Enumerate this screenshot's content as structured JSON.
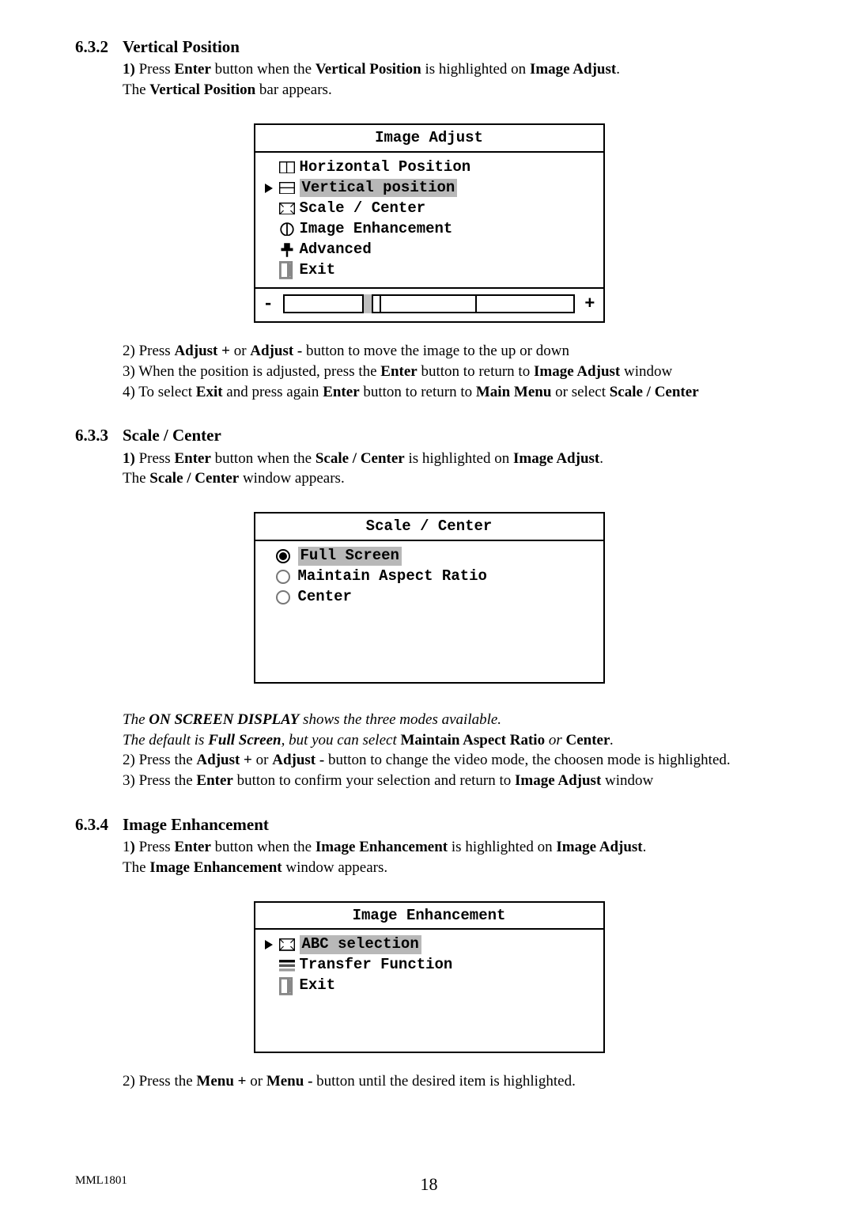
{
  "section632": {
    "num": "6.3.2",
    "title": "Vertical Position"
  },
  "section633": {
    "num": "6.3.3",
    "title": "Scale / Center"
  },
  "section634": {
    "num": "6.3.4",
    "title": "Image Enhancement"
  },
  "p632": {
    "line1a": "1)",
    "line1b": " Press ",
    "line1c": "Enter",
    "line1d": " button when the ",
    "line1e": "Vertical Position",
    "line1f": " is highlighted on ",
    "line1g": "Image Adjust",
    "line1h": ".",
    "line2a": "The ",
    "line2b": "Vertical Position",
    "line2c": " bar appears.",
    "post2": "2) Press ",
    "post2b": "Adjust +",
    "post2c": " or ",
    "post2d": "Adjust -",
    "post2e": " button to move the image to the up or down",
    "post3": "3) When the position is adjusted, press the ",
    "post3b": "Enter",
    "post3c": " button to return to ",
    "post3d": "Image Adjust",
    "post3e": " window",
    "post4": "4) To select ",
    "post4b": "Exit",
    "post4c": " and press again ",
    "post4d": "Enter",
    "post4e": " button to return to ",
    "post4f": "Main Menu",
    "post4g": " or select  ",
    "post4h": "Scale / Center"
  },
  "osd1": {
    "title": "Image Adjust",
    "horizontal": "Horizontal Position",
    "vertical": "Vertical position",
    "scale": "Scale / Center",
    "enhance": "Image Enhancement",
    "advanced": "Advanced",
    "exit": "Exit",
    "minus": "-",
    "plus": "+"
  },
  "p633": {
    "line1a": "1)",
    "line1b": " Press ",
    "line1c": "Enter",
    "line1d": " button when the ",
    "line1e": "Scale / Center",
    "line1f": " is highlighted on ",
    "line1g": "Image Adjust",
    "line1h": ".",
    "line2a": "The ",
    "line2b": "Scale / Center",
    "line2c": " window appears.",
    "post1a": "The ",
    "post1b": "ON SCREEN DISPLAY",
    "post1c": " shows the three modes available.",
    "post2a": " The default is ",
    "post2b": "Full Screen",
    "post2c": ", but you can select ",
    "post2d": "Maintain Aspect Ratio",
    "post2e": " or ",
    "post2f": "Center",
    "post2g": ".",
    "post3a": "2) Press the ",
    "post3b": "Adjust +",
    "post3c": " or ",
    "post3d": "Adjust -",
    "post3e": " button to change the video mode, the choosen mode is highlighted.",
    "post4a": "3) Press the ",
    "post4b": "Enter",
    "post4c": " button to confirm your selection and return to ",
    "post4d": "Image Adjust",
    "post4e": " window"
  },
  "osd2": {
    "title": "Scale / Center",
    "full": "Full Screen",
    "mar": "Maintain Aspect Ratio",
    "center": "Center"
  },
  "p634": {
    "line1a": "1",
    "line1b": ")",
    "line1c": " Press ",
    "line1d": "Enter",
    "line1e": " button when the ",
    "line1f": "Image Enhancement",
    "line1g": " is highlighted on ",
    "line1h": "Image Adjust",
    "line1i": ".",
    "line2a": "The ",
    "line2b": "Image Enhancement",
    "line2c": " window appears.",
    "post1": "2) Press the ",
    "post1b": "Menu +",
    "post1c": " or ",
    "post1d": "Menu -",
    "post1e": " button until the desired item is highlighted."
  },
  "osd3": {
    "title": "Image Enhancement",
    "abc": "ABC selection",
    "tf": "Transfer Function",
    "exit": "Exit"
  },
  "footer": {
    "left": "MML1801",
    "page": "18"
  }
}
